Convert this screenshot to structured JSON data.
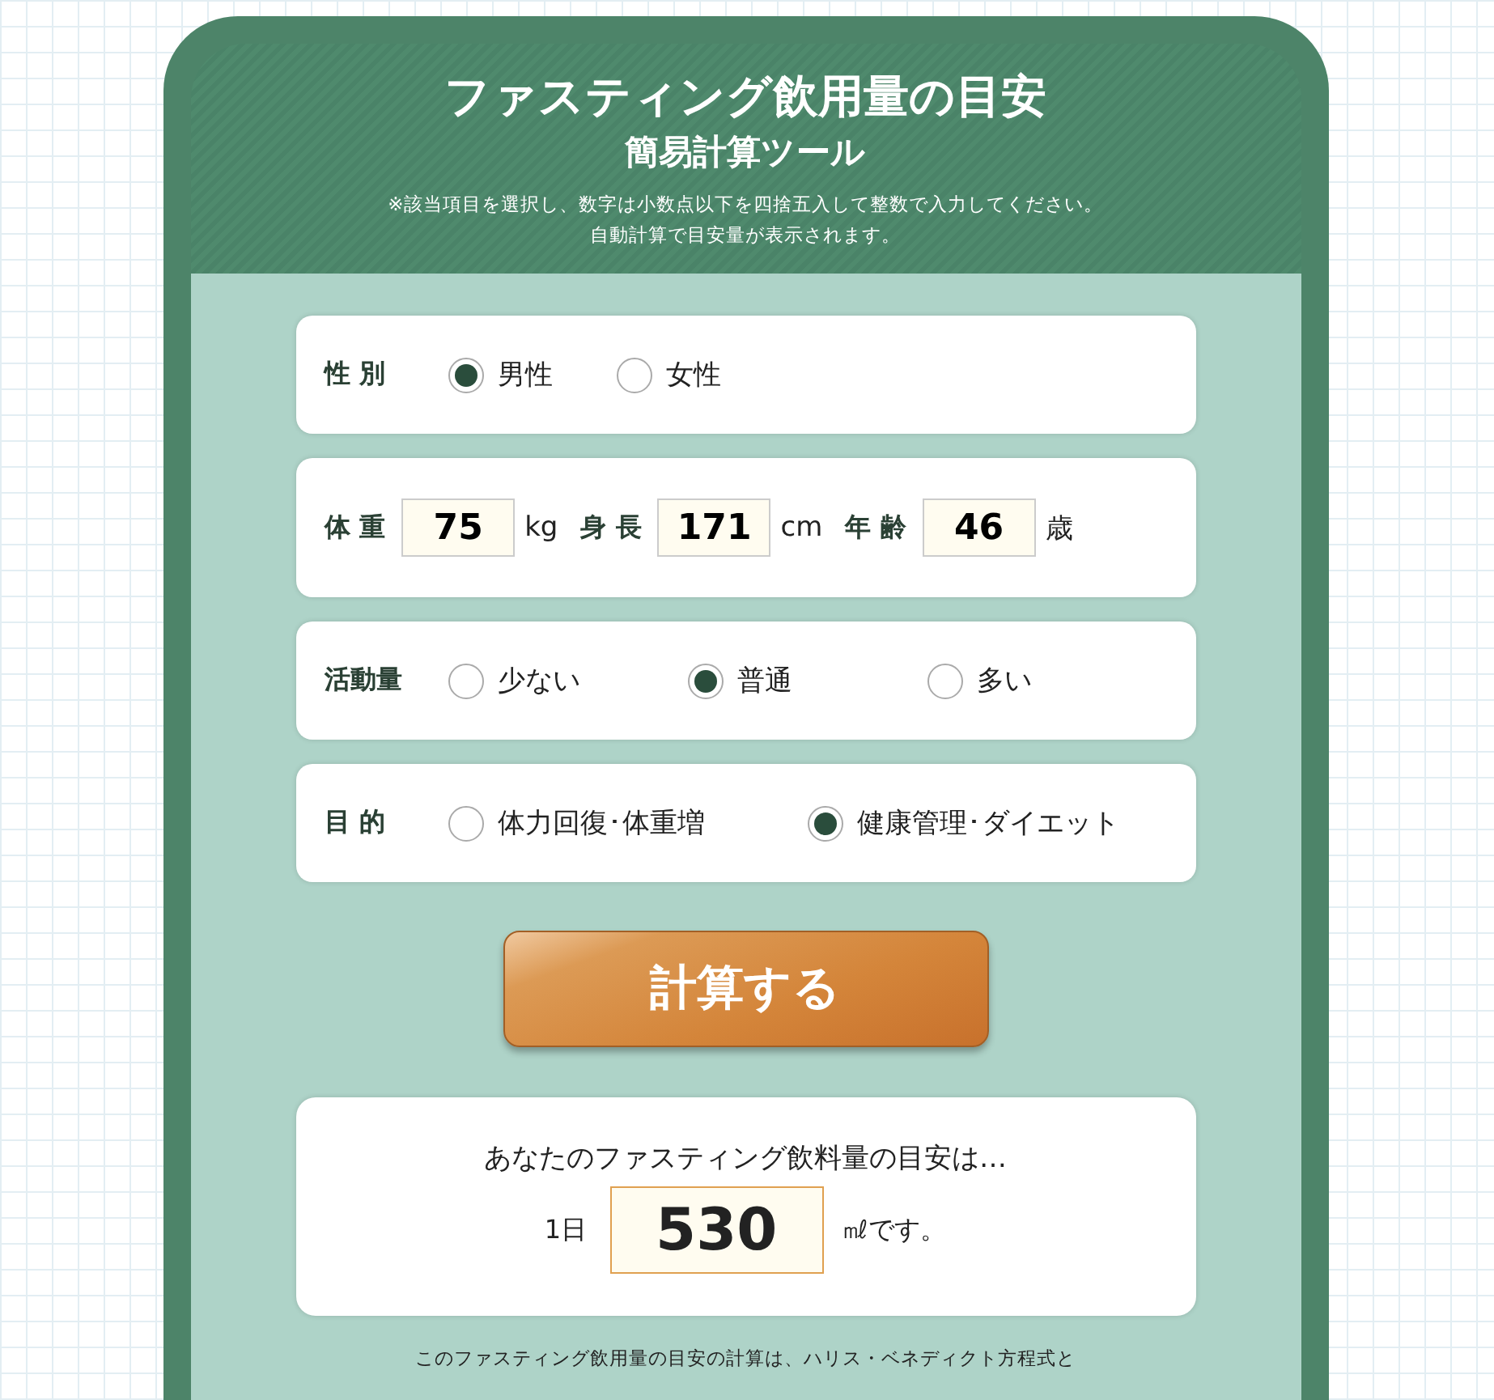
{
  "header": {
    "title": "ファスティング飲用量の目安",
    "subtitle": "簡易計算ツール",
    "notes": [
      "※該当項目を選択し、数字は小数点以下を四捨五入して整数で入力してください。",
      "自動計算で目安量が表示されます。"
    ]
  },
  "rows": [
    {
      "kind": "radio",
      "label": "性 別",
      "options": [
        {
          "label": "男性",
          "selected": true
        },
        {
          "label": "女性",
          "selected": false
        }
      ]
    },
    {
      "kind": "inputs",
      "fields": [
        {
          "label": "体 重",
          "value": "75",
          "unit": "kg"
        },
        {
          "label": "身 長",
          "value": "171",
          "unit": "cm"
        },
        {
          "label": "年 齢",
          "value": "46",
          "unit": "歳"
        }
      ]
    },
    {
      "kind": "radio",
      "label": "活動量",
      "options": [
        {
          "label": "少ない",
          "selected": false
        },
        {
          "label": "普通",
          "selected": true
        },
        {
          "label": "多い",
          "selected": false
        }
      ]
    },
    {
      "kind": "radio",
      "label": "目 的",
      "options": [
        {
          "label": "体力回復･体重増",
          "selected": false
        },
        {
          "label": "健康管理･ダイエット",
          "selected": true
        }
      ]
    }
  ],
  "button": {
    "label": "計算する"
  },
  "result": {
    "intro": "あなたのファスティング飲料量の目安は…",
    "prefix": "1日",
    "value": "530",
    "suffix": "㎖です。"
  },
  "footnote": "このファスティング飲用量の目安の計算は、ハリス・ベネディクト方程式と"
}
